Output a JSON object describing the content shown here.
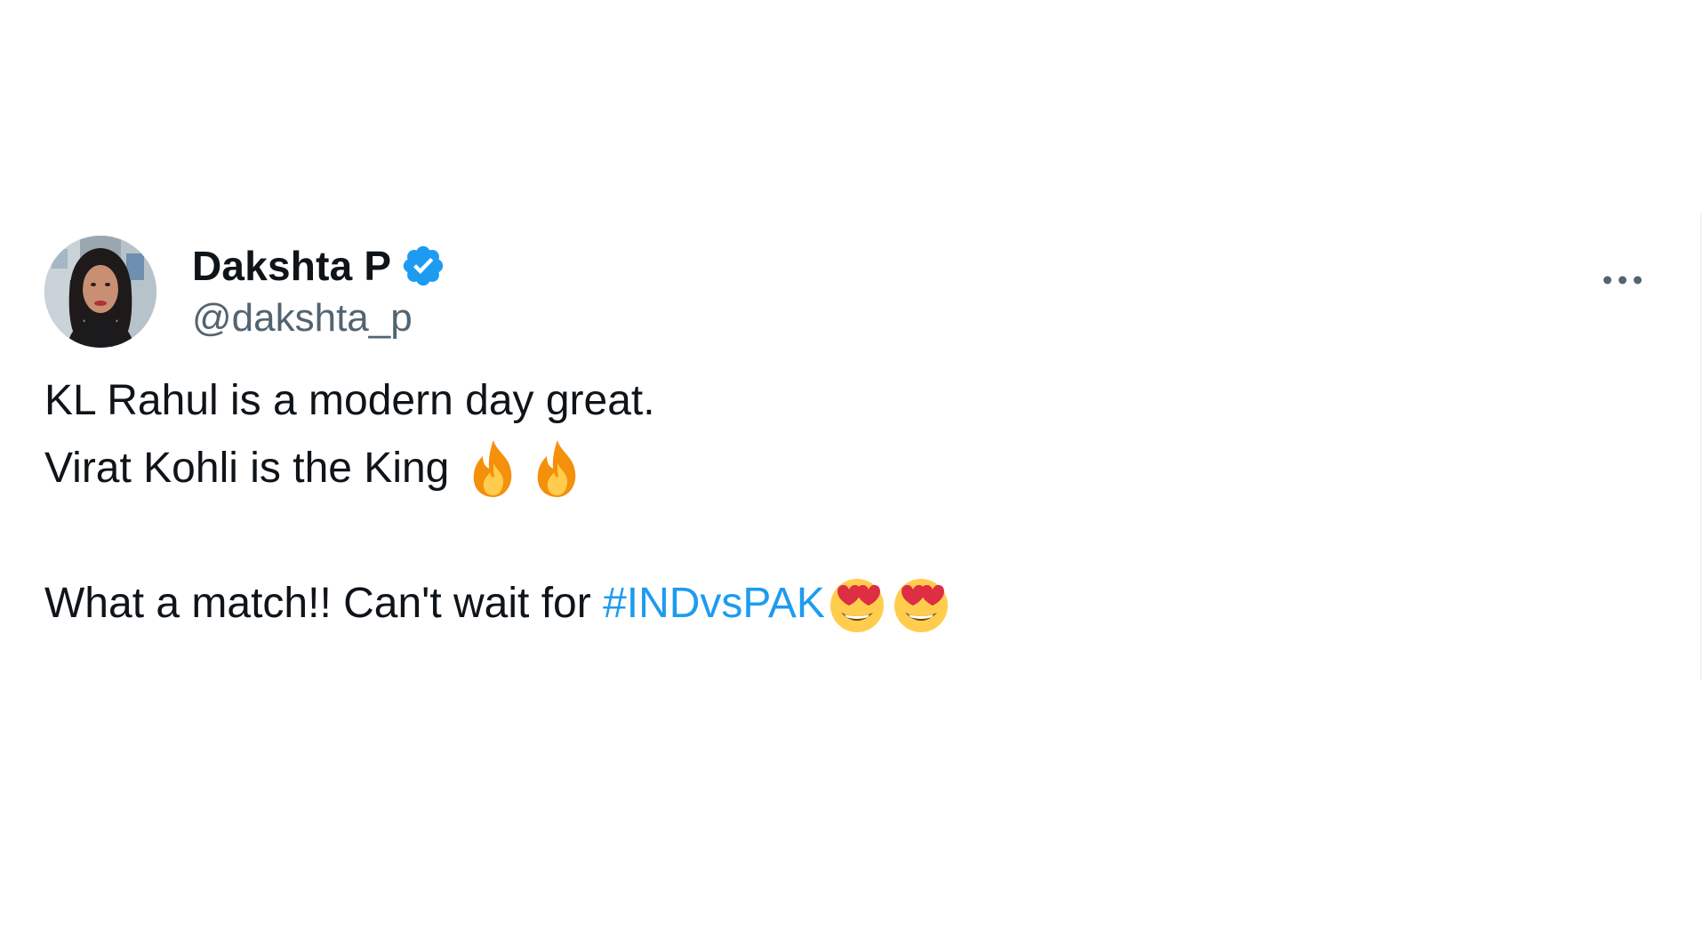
{
  "tweet": {
    "author": {
      "display_name": "Dakshta P",
      "handle": "@dakshta_p",
      "verified": true,
      "verified_color": "#1d9bf0"
    },
    "more_icon": "more-horizontal-icon",
    "lines": {
      "line1": "KL Rahul is a modern day great.",
      "line2": "Virat Kohli is the King",
      "line3_prefix": "What a match!! Can't wait for ",
      "hashtag": "#INDvsPAK"
    },
    "emojis": {
      "line2": [
        "fire-emoji",
        "fire-emoji"
      ],
      "line3": [
        "heart-eyes-emoji",
        "heart-eyes-emoji"
      ]
    },
    "colors": {
      "text": "#0f1419",
      "secondary": "#536471",
      "link": "#1d9bf0"
    }
  }
}
